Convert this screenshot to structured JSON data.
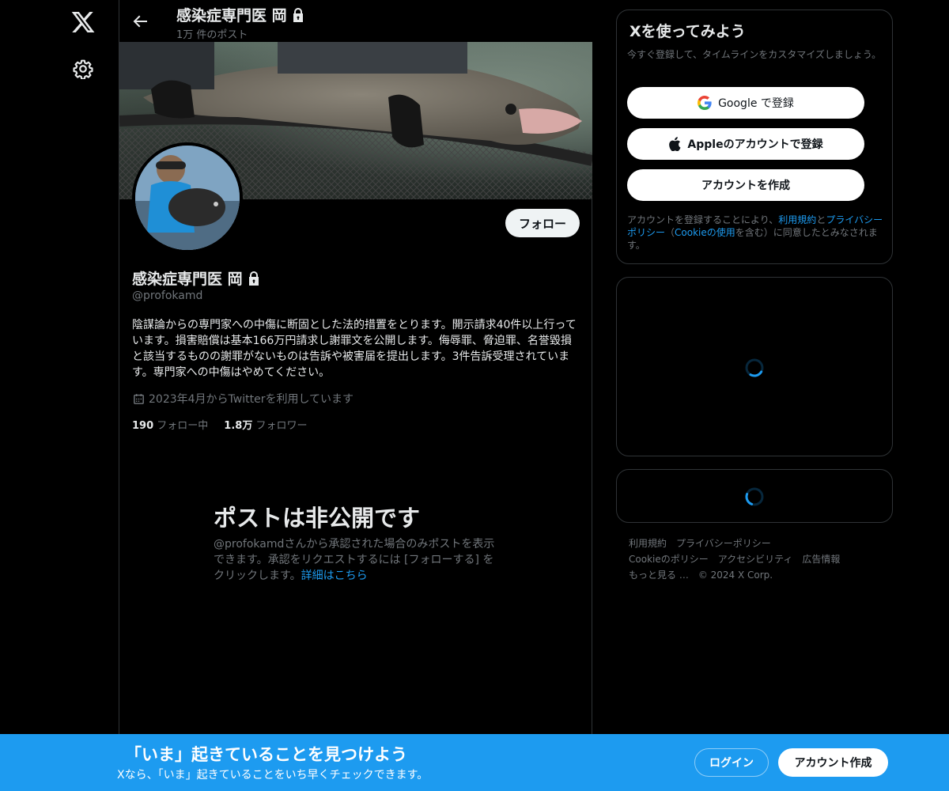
{
  "nav": {
    "logo_icon": "x-logo-icon",
    "settings_icon": "gear-icon"
  },
  "header": {
    "title": "感染症専門医 岡",
    "post_count": "1万 件のポスト"
  },
  "profile": {
    "name": "感染症専門医 岡",
    "handle": "@profokamd",
    "follow_label": "フォロー",
    "bio": "陰謀論からの専門家への中傷に断固とした法的措置をとります。開示請求40件以上行っています。損害賠償は基本166万円請求し謝罪文を公開します。侮辱罪、脅迫罪、名誉毀損と該当するものの謝罪がないものは告訴や被害届を提出します。3件告訴受理されています。専門家への中傷はやめてください。",
    "joined": "2023年4月からTwitterを利用しています",
    "following_count": "190",
    "following_label": "フォロー中",
    "followers_count": "1.8万",
    "followers_label": "フォロワー"
  },
  "private": {
    "title": "ポストは非公開です",
    "desc": "@profokamdさんから承認された場合のみポストを表示できます。承認をリクエストするには [フォローする] をクリックします。",
    "link": "詳細はこちら"
  },
  "signup": {
    "title": "Xを使ってみよう",
    "subtitle": "今すぐ登録して、タイムラインをカスタマイズしましょう。",
    "google_label": "Google で登録",
    "apple_label": "Appleのアカウントで登録",
    "create_label": "アカウントを作成",
    "terms_pre": "アカウントを登録することにより、",
    "terms_link1": "利用規約",
    "terms_and": "と",
    "terms_link2": "プライバシーポリシー",
    "terms_mid": "（",
    "terms_link3": "Cookieの使用",
    "terms_post": "を含む）に同意したとみなされます。"
  },
  "footer": {
    "links": [
      "利用規約",
      "プライバシーポリシー",
      "Cookieのポリシー",
      "アクセシビリティ",
      "広告情報",
      "もっと見る …",
      "© 2024 X Corp."
    ]
  },
  "bottombar": {
    "title": "「いま」起きていることを見つけよう",
    "subtitle": "Xなら、「いま」起きていることをいち早くチェックできます。",
    "login_label": "ログイン",
    "signup_label": "アカウント作成"
  },
  "colors": {
    "accent": "#1d9bf0",
    "background": "#000000",
    "muted": "#71767b"
  }
}
